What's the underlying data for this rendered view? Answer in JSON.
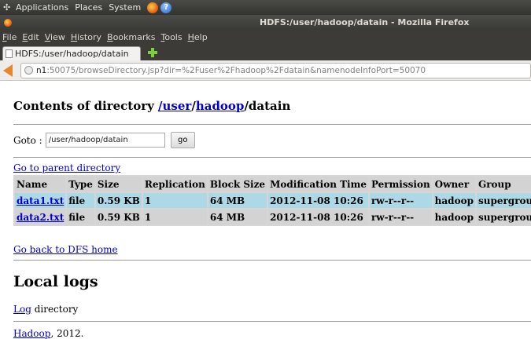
{
  "panel": {
    "menus": [
      "Applications",
      "Places",
      "System"
    ]
  },
  "window": {
    "title": "HDFS:/user/hadoop/datain - Mozilla Firefox"
  },
  "menubar": {
    "items": [
      "File",
      "Edit",
      "View",
      "History",
      "Bookmarks",
      "Tools",
      "Help"
    ]
  },
  "tab": {
    "label": "HDFS:/user/hadoop/datain"
  },
  "urlbar": {
    "host": "n1",
    "rest": ":50075/browseDirectory.jsp?dir=%2Fuser%2Fhadoop%2Fdatain&namenodeInfoPort=50070"
  },
  "page": {
    "heading_prefix": "Contents of directory ",
    "path_sep": "/",
    "path_user": "user",
    "path_hadoop": "hadoop",
    "path_tail": "/datain",
    "goto_label": "Goto :",
    "goto_value": "/user/hadoop/datain",
    "go_button": "go",
    "parent_link": "Go to parent directory",
    "columns": [
      "Name",
      "Type",
      "Size",
      "Replication",
      "Block Size",
      "Modification Time",
      "Permission",
      "Owner",
      "Group"
    ],
    "rows": [
      [
        "data1.txt",
        "file",
        "0.59 KB",
        "1",
        "64 MB",
        "2012-11-08 10:26",
        "rw-r--r--",
        "hadoop",
        "supergroup"
      ],
      [
        "data2.txt",
        "file",
        "0.59 KB",
        "1",
        "64 MB",
        "2012-11-08 10:26",
        "rw-r--r--",
        "hadoop",
        "supergroup"
      ]
    ],
    "dfs_home_link": "Go back to DFS home",
    "local_logs_heading": "Local logs",
    "log_link": "Log",
    "log_suffix": " directory",
    "footer_link": "Hadoop",
    "footer_suffix": ", 2012."
  }
}
